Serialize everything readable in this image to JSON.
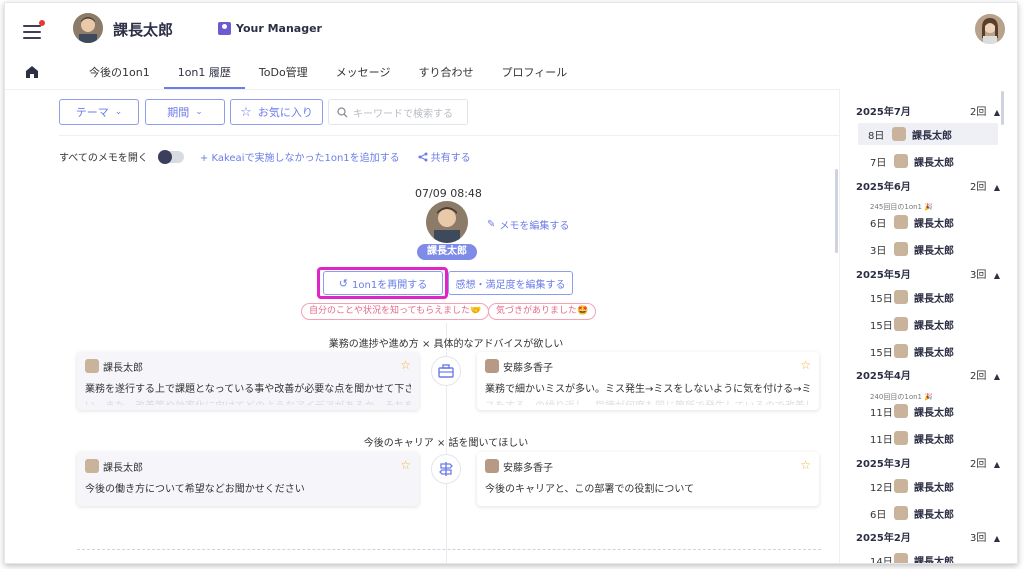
{
  "header": {
    "user_name": "課長太郎",
    "manager_badge": "Your Manager"
  },
  "tabs": [
    "今後の1on1",
    "1on1 履歴",
    "ToDo管理",
    "メッセージ",
    "すり合わせ",
    "プロフィール"
  ],
  "filters": {
    "theme": "テーマ",
    "period": "期間",
    "favorite": "お気に入り",
    "search_placeholder": "キーワードで検索する"
  },
  "memo_bar": {
    "open_all": "すべてのメモを開く",
    "add_outside": "+ Kakeaiで実施しなかった1on1を追加する",
    "share": "共有する"
  },
  "session": {
    "datetime": "07/09 08:48",
    "edit_memo": "メモを編集する",
    "name": "課長太郎",
    "resume_button": "1on1を再開する",
    "feedback_button": "感想・満足度を編集する",
    "tags": [
      "自分のことや状況を知ってもらえました🤝",
      "気づきがありました🤩"
    ]
  },
  "topics": [
    {
      "title": "業務の進捗や進め方 × 具体的なアドバイスが欲しい",
      "icon": "briefcase-icon",
      "left": {
        "author": "課長太郎",
        "text": "業務を遂行する上で課題となっている事や改善が必要な点を聞かせて下さ",
        "faded": "い。また、改善策や効率化に向けてどのようなアイデアがあるか、それを実行する"
      },
      "right": {
        "author": "安藤多香子",
        "text": "業務で細かいミスが多い。ミス発生→ミスをしないように気を付ける→ミ",
        "faded": "スをする…の繰り返し。指摘が何度も同じ箇所で発生しているので改善したい"
      }
    },
    {
      "title": "今後のキャリア × 話を聞いてほしい",
      "icon": "signpost-icon",
      "left": {
        "author": "課長太郎",
        "text": "今後の働き方について希望などお聞かせください",
        "faded": ""
      },
      "right": {
        "author": "安藤多香子",
        "text": "今後のキャリアと、この部署での役割について",
        "faded": ""
      }
    }
  ],
  "history": {
    "months": [
      {
        "label": "2025年7月",
        "count": "2回"
      },
      {
        "label": "2025年6月",
        "count": "2回"
      },
      {
        "label": "2025年5月",
        "count": "3回"
      },
      {
        "label": "2025年4月",
        "count": "2回"
      },
      {
        "label": "2025年3月",
        "count": "2回"
      },
      {
        "label": "2025年2月",
        "count": "3回"
      }
    ],
    "entries": [
      {
        "day": "8日",
        "name": "課長太郎"
      },
      {
        "day": "7日",
        "name": "課長太郎"
      },
      {
        "day": "6日",
        "name": "課長太郎"
      },
      {
        "day": "3日",
        "name": "課長太郎"
      },
      {
        "day": "15日",
        "name": "課長太郎"
      },
      {
        "day": "15日",
        "name": "課長太郎"
      },
      {
        "day": "15日",
        "name": "課長太郎"
      },
      {
        "day": "11日",
        "name": "課長太郎"
      },
      {
        "day": "11日",
        "name": "課長太郎"
      },
      {
        "day": "12日",
        "name": "課長太郎"
      },
      {
        "day": "6日",
        "name": "課長太郎"
      },
      {
        "day": "14日",
        "name": "課長太郎"
      }
    ],
    "round_notes": [
      "245回目の1on1 🎉",
      "240回目の1on1 🎉"
    ]
  },
  "colors": {
    "accent": "#6b7de8",
    "highlight": "#e024c6",
    "star": "#f0b43a",
    "tag": "#e56a8a"
  }
}
